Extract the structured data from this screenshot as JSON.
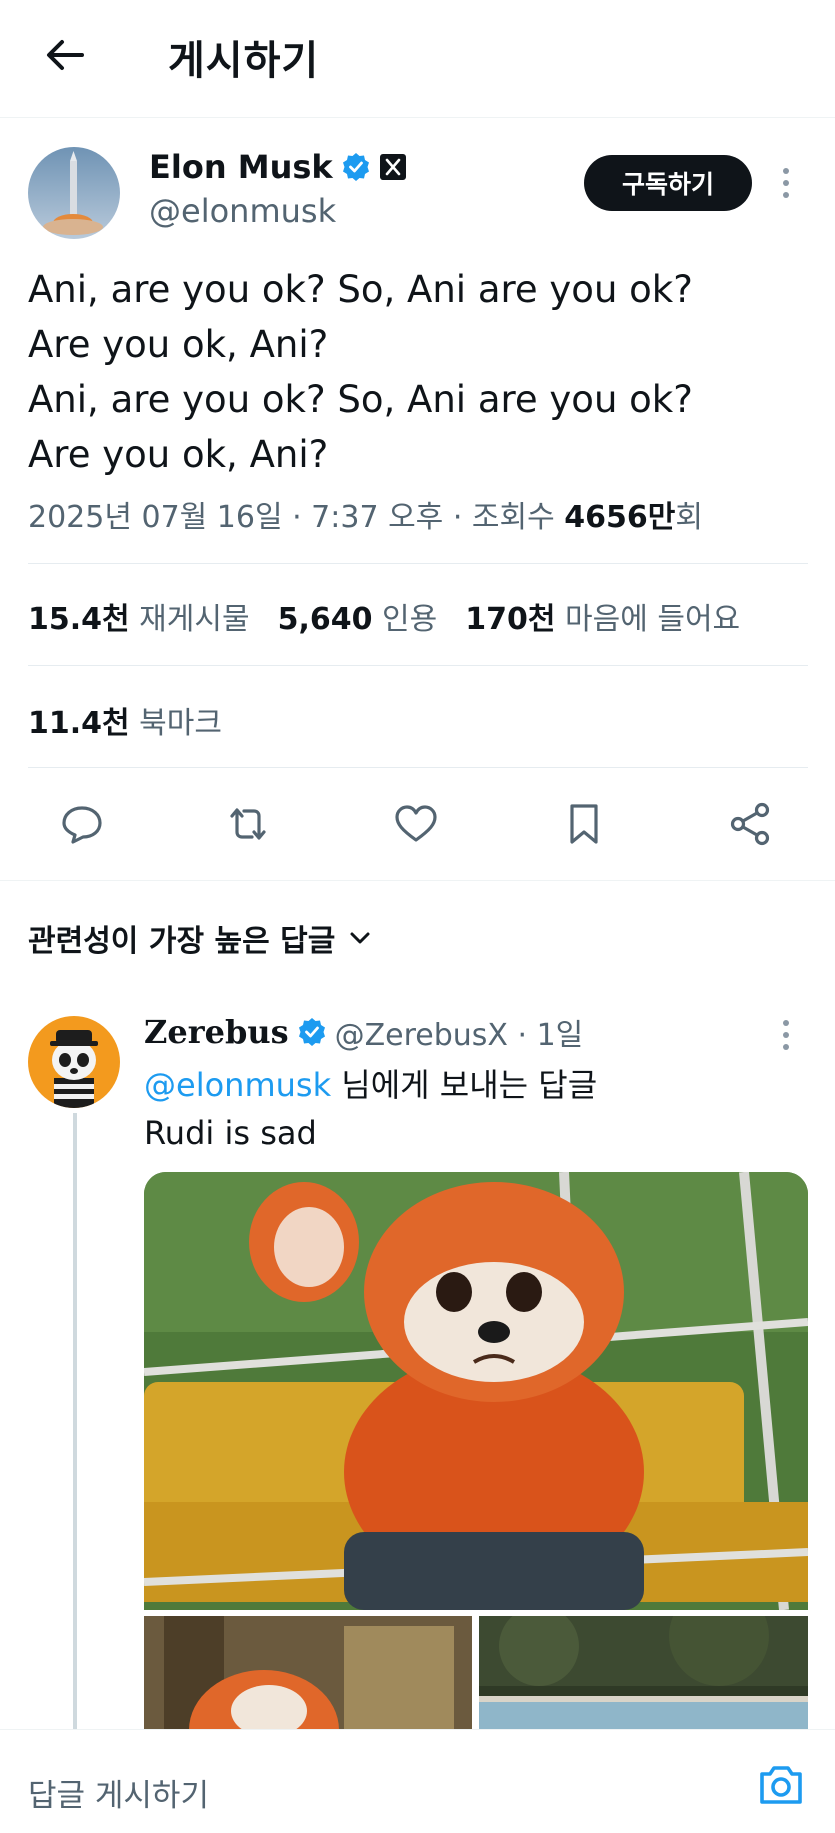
{
  "header": {
    "title": "게시하기"
  },
  "post": {
    "author_name": "Elon Musk",
    "author_handle": "@elonmusk",
    "subscribe_label": "구독하기",
    "text_lines": [
      "Ani, are you ok? So, Ani are you ok?",
      "Are you ok, Ani?",
      "Ani, are you ok? So, Ani are you ok?",
      "Are you ok, Ani?"
    ],
    "meta": {
      "datetime": "2025년 07월 16일 · 7:37 오후 · 조회수 ",
      "views": "4656만",
      "views_suffix": "회"
    },
    "stats": {
      "reposts_value": "15.4천",
      "reposts_label": "재게시물",
      "quotes_value": "5,640",
      "quotes_label": "인용",
      "likes_value": "170천",
      "likes_label": "마음에 들어요",
      "bookmarks_value": "11.4천",
      "bookmarks_label": "북마크"
    }
  },
  "replies": {
    "sort_label": "관련성이 가장 높은 답글",
    "items": [
      {
        "name": "Zerebus",
        "handle": "@ZerebusX",
        "time": " · 1일",
        "reply_to_mention": "@elonmusk",
        "reply_to_suffix": " 님에게 보내는 답글",
        "text": "Rudi is sad"
      }
    ]
  },
  "footer": {
    "reply_placeholder": "답글 게시하기"
  },
  "colors": {
    "accent": "#1d9bf0",
    "text": "#0f1419",
    "secondary": "#536471",
    "button_bg": "#0f1419"
  },
  "icons": [
    "back-arrow-icon",
    "verified-badge-icon",
    "x-affiliate-icon",
    "more-icon",
    "reply-icon",
    "repost-icon",
    "like-icon",
    "bookmark-icon",
    "share-icon",
    "chevron-down-icon",
    "camera-icon"
  ]
}
